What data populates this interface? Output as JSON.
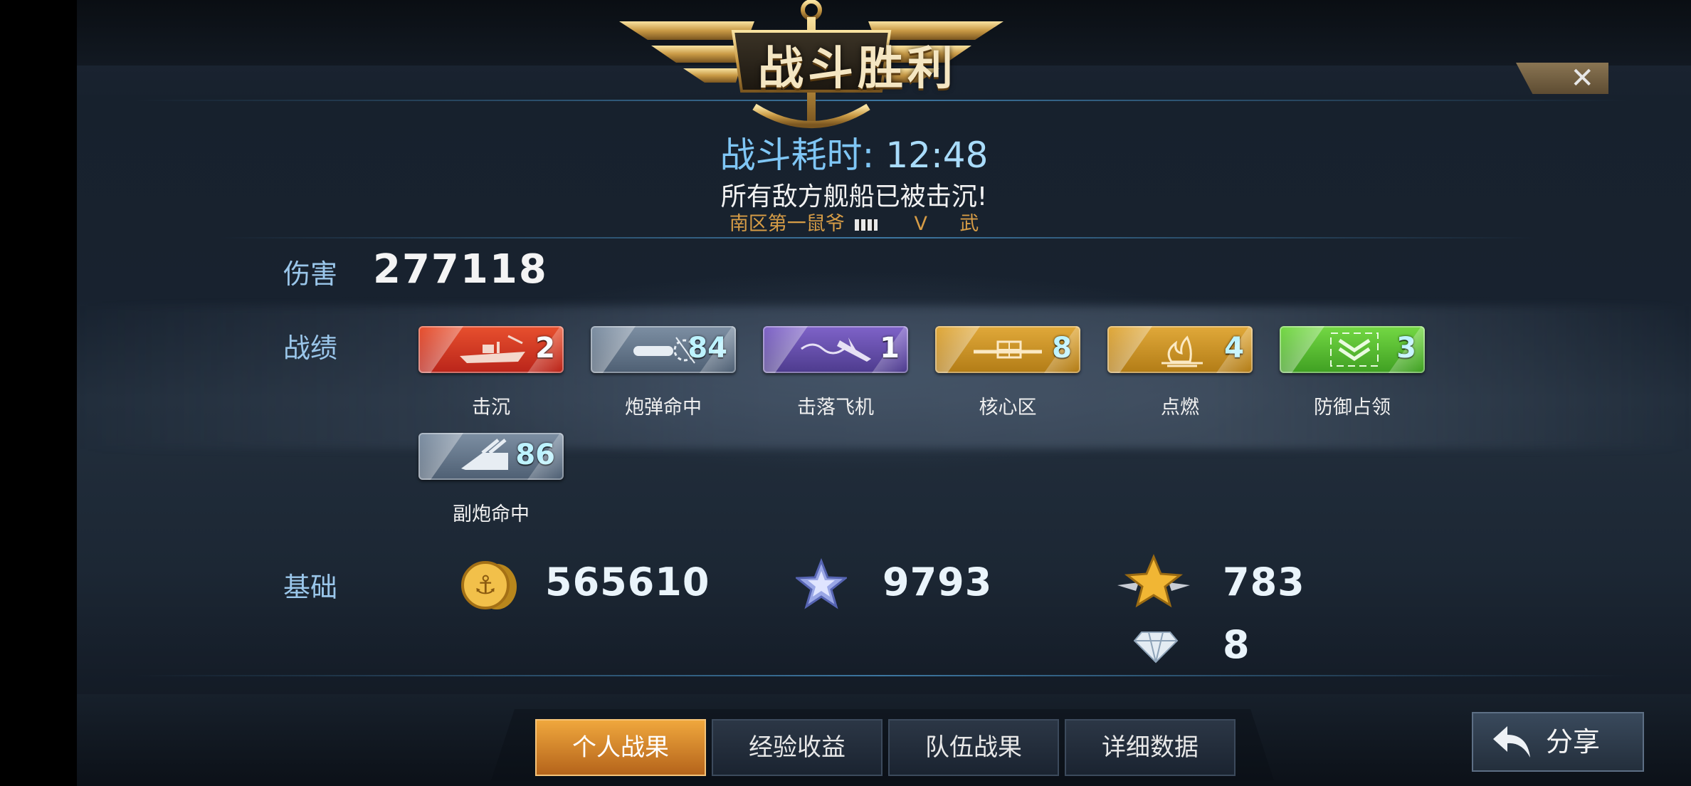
{
  "header": {
    "title": "战斗胜利",
    "close_label": "✕"
  },
  "battle": {
    "time_label": "战斗耗时:",
    "time_value": "12:48",
    "message": "所有敌方舰船已被击沉!",
    "player_name": "南区第一鼠爷",
    "player_rank": "V",
    "player_class": "武"
  },
  "damage": {
    "label": "伤害",
    "value": "277118"
  },
  "stats": {
    "label": "战绩",
    "medals": [
      {
        "name": "击沉",
        "count": "2",
        "icon": "warship-icon",
        "color": "#d8341f"
      },
      {
        "name": "炮弹命中",
        "count": "84",
        "icon": "shell-hit-icon",
        "color": "#627488"
      },
      {
        "name": "击落飞机",
        "count": "1",
        "icon": "plane-shotdown-icon",
        "color": "#6550ab"
      },
      {
        "name": "核心区",
        "count": "8",
        "icon": "core-zone-icon",
        "color": "#c99229"
      },
      {
        "name": "点燃",
        "count": "4",
        "icon": "fire-icon",
        "color": "#c99229"
      },
      {
        "name": "防御占领",
        "count": "3",
        "icon": "defend-chevron-icon",
        "color": "#57bc33"
      },
      {
        "name": "副炮命中",
        "count": "86",
        "icon": "secondary-gun-icon",
        "color": "#627488"
      }
    ]
  },
  "basic": {
    "label": "基础",
    "coins": "565610",
    "silver_star": "9793",
    "gold_star": "783",
    "diamond": "8"
  },
  "tabs": [
    "个人战果",
    "经验收益",
    "队伍战果",
    "详细数据"
  ],
  "share_label": "分享"
}
